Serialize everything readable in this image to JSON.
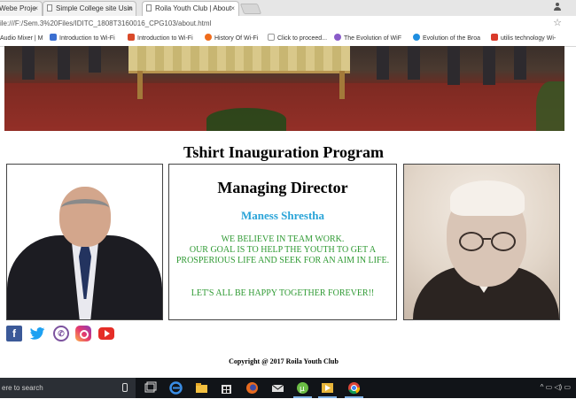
{
  "browser": {
    "tabs": [
      {
        "label": "Webe Proje",
        "active": false
      },
      {
        "label": "Simple College site Usin",
        "active": false
      },
      {
        "label": "Roila Youth Club | About",
        "active": true
      }
    ],
    "address": "ile:///F:/Sem.3%20Files/IDITC_1808T3160016_CPG103/about.html",
    "bookmarks": [
      {
        "label": "Audio Mixer | M",
        "color": "#9a9a9a"
      },
      {
        "label": "Introduction to Wi-Fi",
        "color": "#3b6fd1"
      },
      {
        "label": "Introduction to Wi-Fi",
        "color": "#d94a2a"
      },
      {
        "label": "History Of Wi-Fi",
        "color": "#ef6c1c"
      },
      {
        "label": "Click to proceed...",
        "color": "#9a9a9a"
      },
      {
        "label": "The Evolution of WiF",
        "color": "#8a5cc9"
      },
      {
        "label": "Evolution of the Broa",
        "color": "#1f8ee0"
      },
      {
        "label": "utilis technology Wi-",
        "color": "#d93a2a"
      }
    ]
  },
  "page": {
    "title": "Tshirt Inauguration Program",
    "director": {
      "heading": "Managing Director",
      "name": "Maness Shrestha",
      "quote_lines": [
        "WE BELIEVE IN TEAM WORK.",
        "OUR GOAL IS TO HELP THE YOUTH TO GET A",
        "PROSPERIOUS LIFE AND SEEK FOR AN AIM IN LIFE."
      ],
      "closing": "LET'S ALL BE HAPPY TOGETHER FOREVER!!"
    },
    "social": [
      "facebook-icon",
      "twitter-icon",
      "viber-icon",
      "instagram-icon",
      "youtube-icon"
    ],
    "copyright": "Copyright @ 2017 Roila Youth Club"
  },
  "taskbar": {
    "search_placeholder": "ere to search",
    "apps": [
      "task-view-icon",
      "edge-icon",
      "file-explorer-icon",
      "store-icon",
      "firefox-icon",
      "mail-icon",
      "utorrent-icon",
      "media-player-icon",
      "chrome-icon"
    ]
  }
}
